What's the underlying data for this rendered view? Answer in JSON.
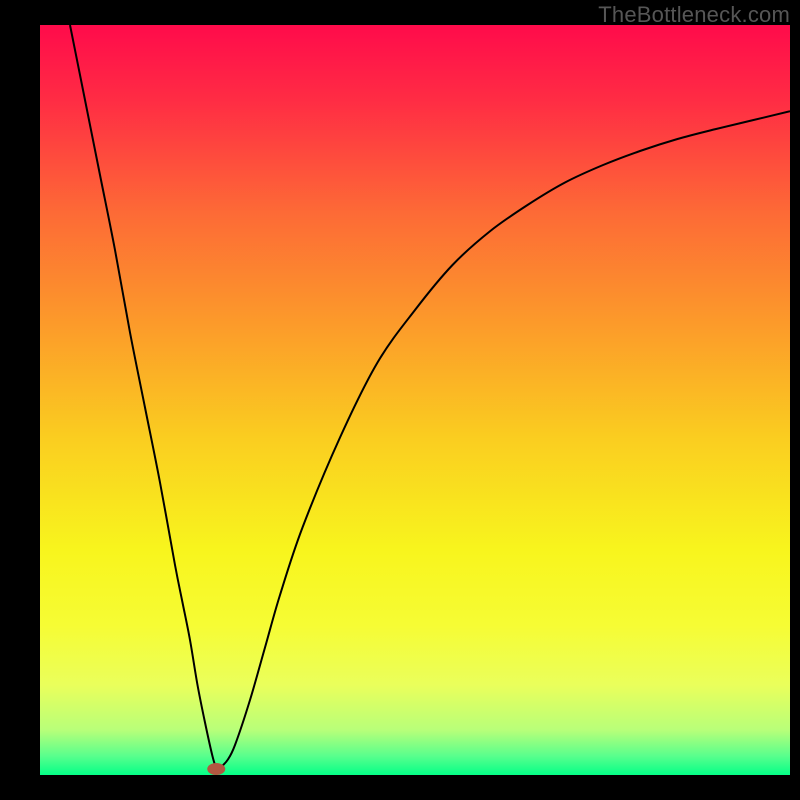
{
  "watermark": "TheBottleneck.com",
  "chart_data": {
    "type": "line",
    "title": "",
    "xlabel": "",
    "ylabel": "",
    "xlim": [
      0,
      100
    ],
    "ylim": [
      0,
      100
    ],
    "grid": false,
    "legend": false,
    "background_gradient_stops": [
      {
        "offset": 0.0,
        "color": "#ff0b4b"
      },
      {
        "offset": 0.1,
        "color": "#ff2c44"
      },
      {
        "offset": 0.25,
        "color": "#fd6a36"
      },
      {
        "offset": 0.4,
        "color": "#fc9b2a"
      },
      {
        "offset": 0.55,
        "color": "#facd20"
      },
      {
        "offset": 0.7,
        "color": "#f8f51d"
      },
      {
        "offset": 0.8,
        "color": "#f6fc34"
      },
      {
        "offset": 0.88,
        "color": "#eaff5b"
      },
      {
        "offset": 0.94,
        "color": "#b8ff79"
      },
      {
        "offset": 0.975,
        "color": "#58ff8d"
      },
      {
        "offset": 1.0,
        "color": "#05ff87"
      }
    ],
    "series": [
      {
        "name": "bottleneck-curve",
        "x": [
          4,
          6,
          8,
          10,
          12,
          14,
          16,
          18,
          19,
          20,
          21,
          22,
          23,
          23.5,
          24,
          25,
          26,
          28,
          30,
          32,
          35,
          40,
          45,
          50,
          55,
          60,
          65,
          70,
          75,
          80,
          85,
          90,
          95,
          100
        ],
        "y": [
          100,
          90,
          80,
          70,
          59,
          49,
          39,
          28,
          23,
          18,
          12,
          7,
          2.5,
          1,
          1,
          2,
          4,
          10,
          17,
          24,
          33,
          45,
          55,
          62,
          68,
          72.5,
          76,
          79,
          81.3,
          83.2,
          84.8,
          86.1,
          87.3,
          88.5
        ]
      }
    ],
    "marker": {
      "name": "optimal-point",
      "x": 23.5,
      "y": 0.8,
      "color": "#b25741"
    }
  }
}
